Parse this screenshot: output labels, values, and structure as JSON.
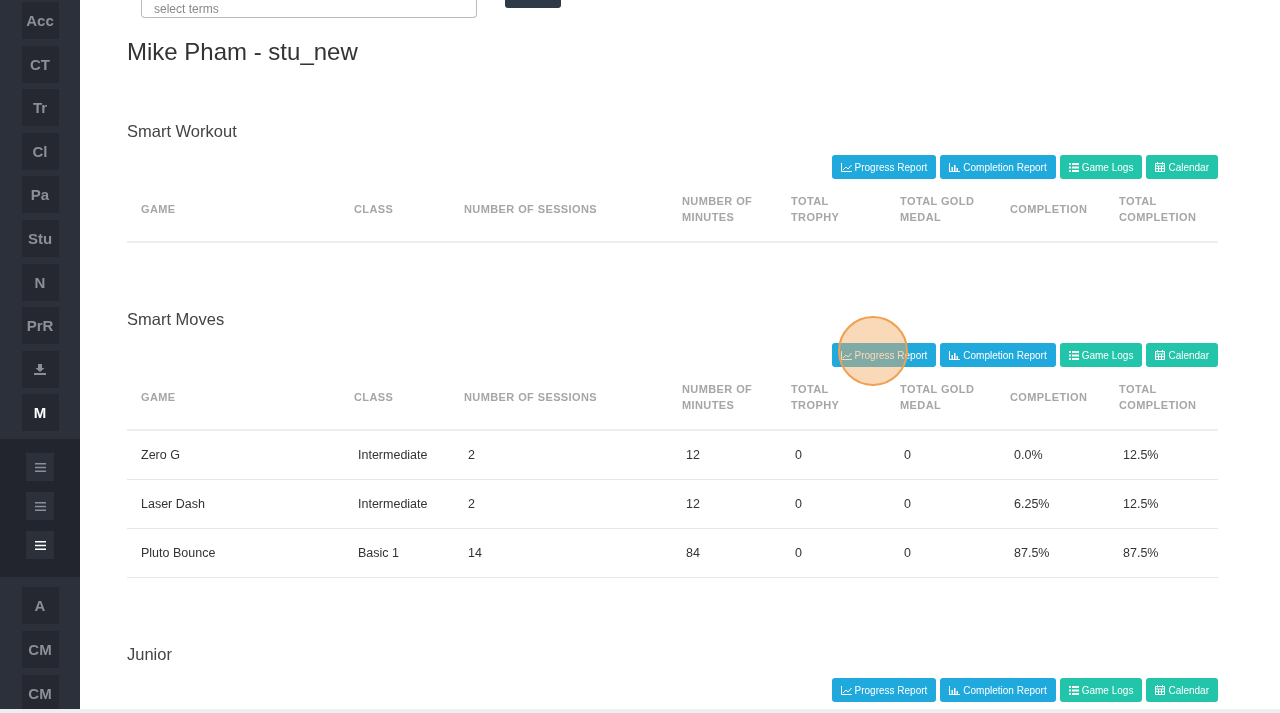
{
  "sidebar": {
    "items": [
      {
        "kind": "text",
        "label": "Acc",
        "selected": false
      },
      {
        "kind": "text",
        "label": "CT",
        "selected": false
      },
      {
        "kind": "text",
        "label": "Tr",
        "selected": false
      },
      {
        "kind": "text",
        "label": "Cl",
        "selected": false
      },
      {
        "kind": "text",
        "label": "Pa",
        "selected": false
      },
      {
        "kind": "text",
        "label": "Stu",
        "selected": false
      },
      {
        "kind": "text",
        "label": "N",
        "selected": false
      },
      {
        "kind": "text",
        "label": "PrR",
        "selected": false
      },
      {
        "kind": "download",
        "selected": false
      },
      {
        "kind": "text",
        "label": "M",
        "selected": true
      }
    ],
    "subitems": [
      {
        "selected": false
      },
      {
        "selected": false
      },
      {
        "selected": true
      }
    ],
    "bottom_items": [
      {
        "label": "A",
        "selected": false
      },
      {
        "label": "CM",
        "selected": false
      },
      {
        "label": "CM",
        "selected": false
      }
    ]
  },
  "term_select": {
    "placeholder": "select terms"
  },
  "title": "Mike Pham - stu_new",
  "sections": [
    {
      "title": "Smart Workout",
      "buttons": [
        {
          "kind": "line-chart",
          "label": "Progress Report",
          "color": "#1fa9dd"
        },
        {
          "kind": "bar-chart",
          "label": "Completion Report",
          "color": "#1fa9dd"
        },
        {
          "kind": "list",
          "label": "Game Logs",
          "color": "#22c4aa"
        },
        {
          "kind": "calendar",
          "label": "Calendar",
          "color": "#22c4aa"
        }
      ],
      "columns": [
        "GAME",
        "CLASS",
        "NUMBER OF SESSIONS",
        "NUMBER OF MINUTES",
        "TOTAL TROPHY",
        "TOTAL GOLD MEDAL",
        "COMPLETION",
        "TOTAL COMPLETION"
      ]
    },
    {
      "title": "Smart Moves",
      "buttons": [
        {
          "kind": "line-chart",
          "label": "Progress Report",
          "color": "#1fa9dd"
        },
        {
          "kind": "bar-chart",
          "label": "Completion Report",
          "color": "#1fa9dd"
        },
        {
          "kind": "list",
          "label": "Game Logs",
          "color": "#22c4aa"
        },
        {
          "kind": "calendar",
          "label": "Calendar",
          "color": "#22c4aa"
        }
      ],
      "columns": [
        "GAME",
        "CLASS",
        "NUMBER OF SESSIONS",
        "NUMBER OF MINUTES",
        "TOTAL TROPHY",
        "TOTAL GOLD MEDAL",
        "COMPLETION",
        "TOTAL COMPLETION"
      ],
      "rows": [
        [
          "Zero G",
          "Intermediate",
          "2",
          "12",
          "0",
          "0",
          "0.0%",
          "12.5%"
        ],
        [
          "Laser Dash",
          "Intermediate",
          "2",
          "12",
          "0",
          "0",
          "6.25%",
          "12.5%"
        ],
        [
          "Pluto Bounce",
          "Basic 1",
          "14",
          "84",
          "0",
          "0",
          "87.5%",
          "87.5%"
        ]
      ]
    },
    {
      "title": "Junior",
      "buttons": [
        {
          "kind": "line-chart",
          "label": "Progress Report",
          "color": "#1fa9dd"
        },
        {
          "kind": "bar-chart",
          "label": "Completion Report",
          "color": "#1fa9dd"
        },
        {
          "kind": "list",
          "label": "Game Logs",
          "color": "#22c4aa"
        },
        {
          "kind": "calendar",
          "label": "Calendar",
          "color": "#22c4aa"
        }
      ]
    }
  ]
}
